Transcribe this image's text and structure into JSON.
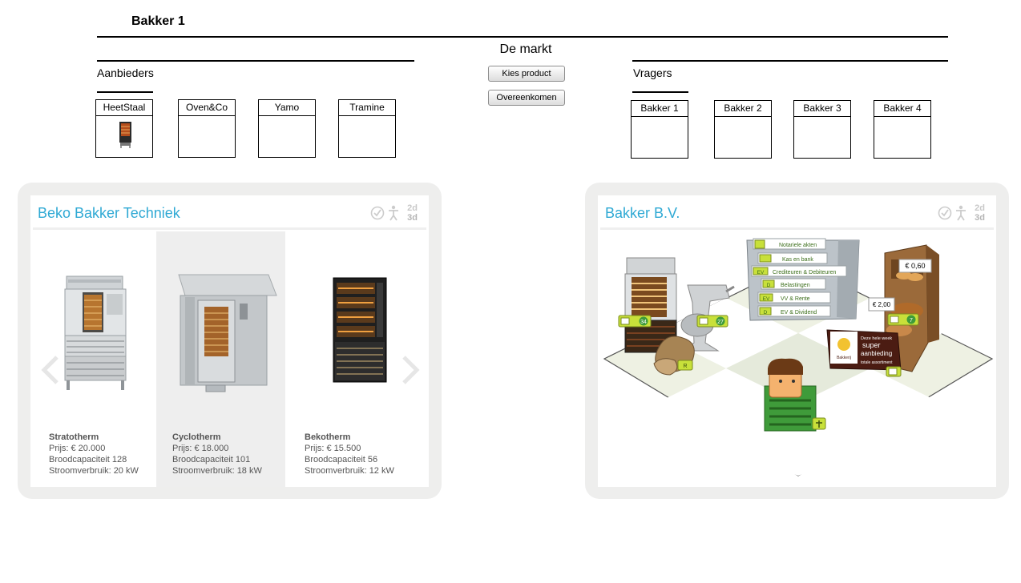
{
  "header": {
    "user_title": "Bakker 1",
    "market_title": "De markt"
  },
  "suppliers": {
    "label": "Aanbieders",
    "items": [
      {
        "name": "HeetStaal"
      },
      {
        "name": "Oven&Co"
      },
      {
        "name": "Yamo"
      },
      {
        "name": "Tramine"
      }
    ]
  },
  "buyers": {
    "label": "Vragers",
    "items": [
      {
        "name": "Bakker 1"
      },
      {
        "name": "Bakker 2"
      },
      {
        "name": "Bakker 3"
      },
      {
        "name": "Bakker 4"
      }
    ]
  },
  "actions": {
    "choose_product": "Kies product",
    "agree": "Overeenkomen"
  },
  "supplier_panel": {
    "title": "Beko Bakker Techniek",
    "view_2d": "2d",
    "view_3d": "3d",
    "products": [
      {
        "name": "Stratotherm",
        "price": "Prijs: € 20.000",
        "capacity": "Broodcapaciteit 128",
        "power": "Stroomverbruik: 20 kW"
      },
      {
        "name": "Cyclotherm",
        "price": "Prijs: € 18.000",
        "capacity": "Broodcapaciteit 101",
        "power": "Stroomverbruik: 18 kW"
      },
      {
        "name": "Bekotherm",
        "price": "Prijs: € 15.500",
        "capacity": "Broodcapaciteit 56",
        "power": "Stroomverbruik: 12 kW"
      }
    ]
  },
  "buyer_panel": {
    "title": "Bakker B.V.",
    "view_2d": "2d",
    "view_3d": "3d",
    "cabinet_labels": [
      "Notariele akten",
      "Kas en bank",
      "Crediteuren & Debiteuren",
      "Belastingen",
      "VV & Rente",
      "EV & Dividend"
    ],
    "cabinet_codes": [
      "",
      "",
      "EV",
      "D",
      "EV",
      "D"
    ],
    "price_1": "€ 0,60",
    "price_2": "€ 2,00",
    "badge_oven": "34",
    "badge_mixer": "27",
    "badge_shelf": "7",
    "badge_flour": "R",
    "ad_line_1": "Deze hele week",
    "ad_line_2": "super",
    "ad_line_3": "aanbieding",
    "ad_line_4": "totale assortiment",
    "ad_logo": "Bakkerij"
  },
  "colors": {
    "panel_title": "#2fa9d4",
    "tag_green": "#c8e03a",
    "panel_bg": "#eeeeed"
  }
}
